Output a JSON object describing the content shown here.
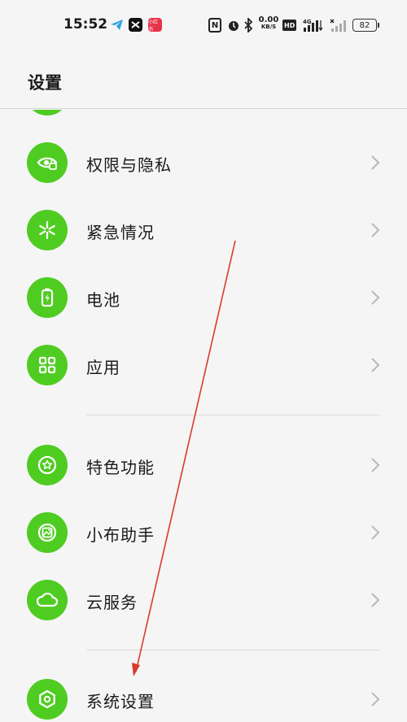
{
  "status_bar": {
    "time": "15:52",
    "net_speed_value": "0.00",
    "net_speed_unit": "KB/S",
    "hd_label": "HD",
    "signal_label_1": "4G",
    "battery": "82",
    "red_app_label": "小红书",
    "nfc_label": "N"
  },
  "header": {
    "title": "设置"
  },
  "menu": {
    "items": [
      {
        "label": "权限与隐私",
        "icon": "eye-lock-icon"
      },
      {
        "label": "紧急情况",
        "icon": "asterisk-icon"
      },
      {
        "label": "电池",
        "icon": "battery-charging-icon"
      },
      {
        "label": "应用",
        "icon": "grid-apps-icon"
      },
      {
        "label": "特色功能",
        "icon": "star-circle-icon"
      },
      {
        "label": "小布助手",
        "icon": "assistant-icon"
      },
      {
        "label": "云服务",
        "icon": "cloud-icon"
      },
      {
        "label": "系统设置",
        "icon": "hexagon-settings-icon"
      }
    ]
  },
  "colors": {
    "icon_green": "#4fcc21",
    "background": "#f5f5f5",
    "annotation_arrow": "#d93a2b"
  }
}
